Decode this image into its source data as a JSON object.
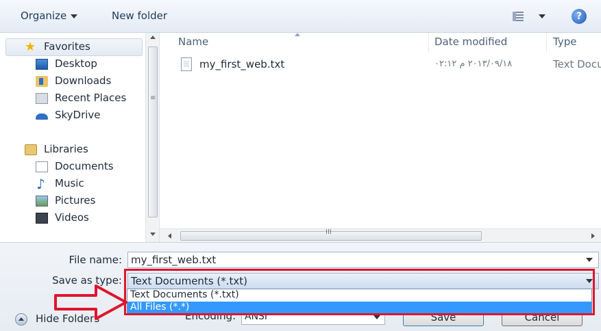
{
  "toolbar": {
    "organize_label": "Organize",
    "new_folder_label": "New folder",
    "view_icon": "view-list-icon",
    "help_icon": "help-icon"
  },
  "nav": {
    "favorites_label": "Favorites",
    "items": [
      {
        "label": "Desktop",
        "icon": "desktop-icon"
      },
      {
        "label": "Downloads",
        "icon": "downloads-icon"
      },
      {
        "label": "Recent Places",
        "icon": "recent-places-icon"
      },
      {
        "label": "SkyDrive",
        "icon": "skydrive-icon"
      }
    ],
    "libraries_label": "Libraries",
    "library_items": [
      {
        "label": "Documents",
        "icon": "documents-icon"
      },
      {
        "label": "Music",
        "icon": "music-icon"
      },
      {
        "label": "Pictures",
        "icon": "pictures-icon"
      },
      {
        "label": "Videos",
        "icon": "videos-icon"
      }
    ]
  },
  "files": {
    "columns": [
      "Name",
      "Date modified",
      "Type"
    ],
    "rows": [
      {
        "name": "my_first_web.txt",
        "date": "٢٠١٣/٠٩/١٨ م ٠٢:١٢",
        "type": "Text Docu"
      }
    ]
  },
  "form": {
    "file_name_label": "File name:",
    "file_name_value": "my_first_web.txt",
    "save_as_type_label": "Save as type:",
    "save_as_type_value": "Text Documents (*.txt)",
    "save_as_type_options": [
      "Text Documents (*.txt)",
      "All Files  (*.*)"
    ],
    "encoding_label": "Encoding:",
    "encoding_value": "ANSI",
    "save_label": "Save",
    "cancel_label": "Cancel",
    "hide_folders_label": "Hide Folders"
  },
  "colors": {
    "highlight": "#e0142e",
    "selected_option": "#3399ff"
  }
}
